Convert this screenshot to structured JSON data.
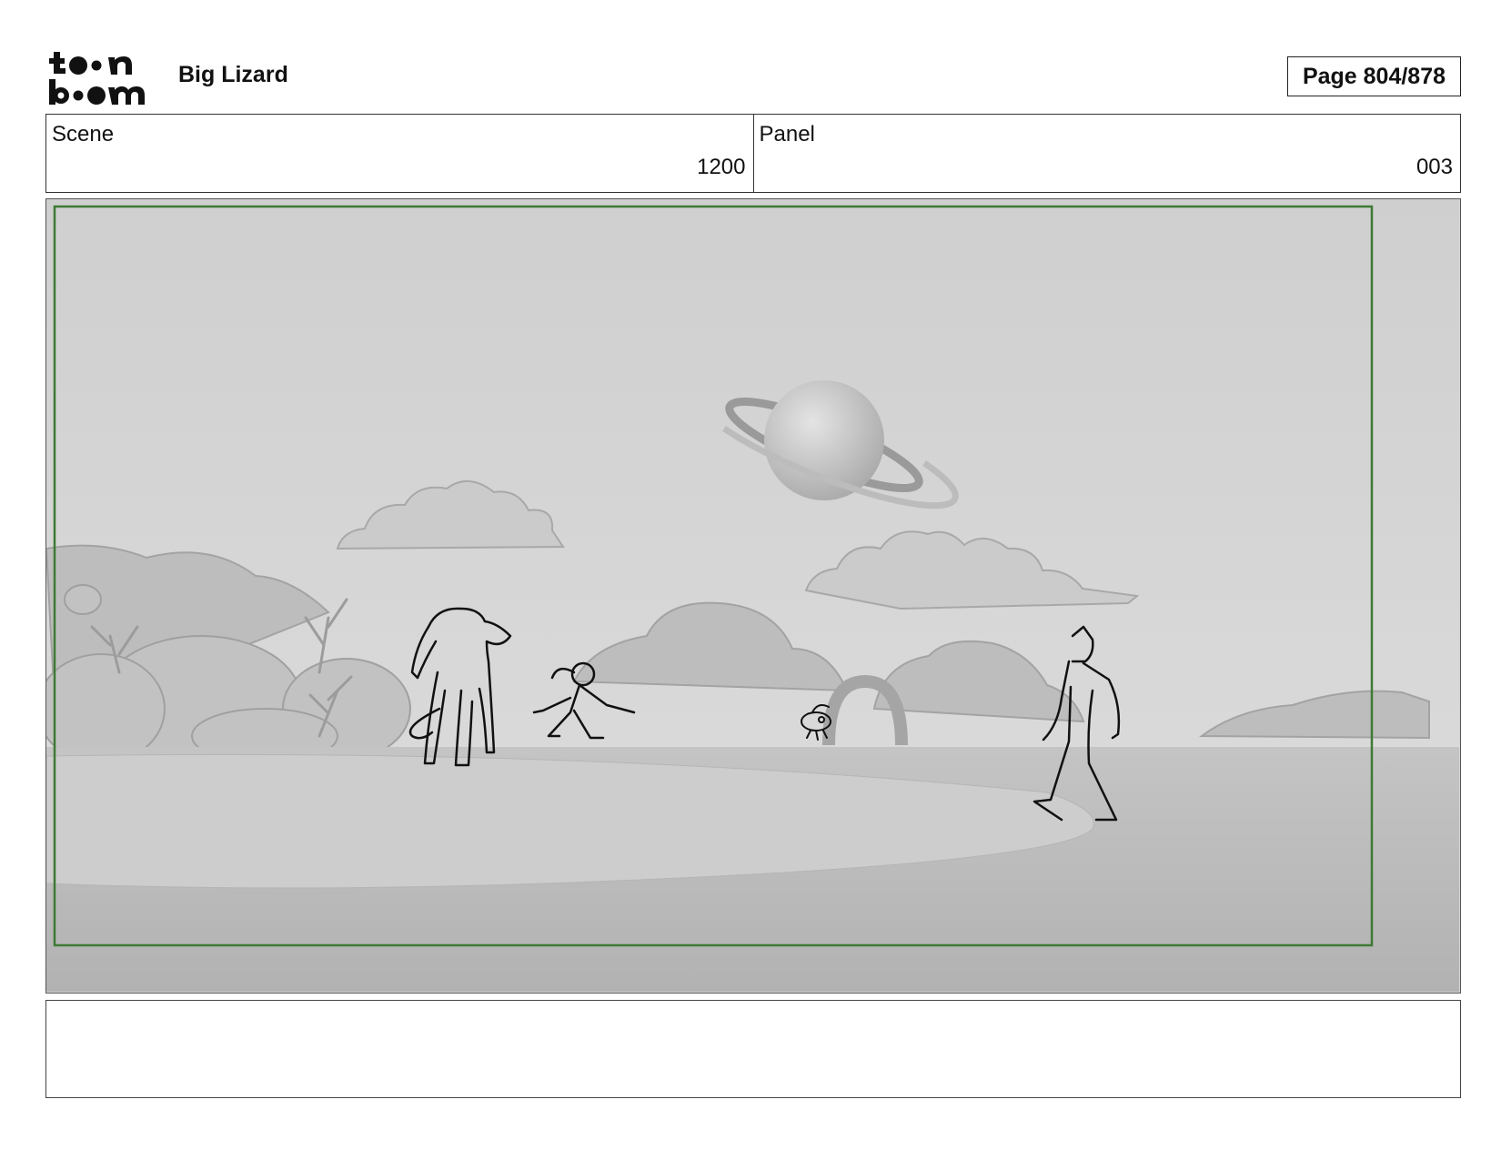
{
  "header": {
    "logo_text": "toon boom",
    "project_title": "Big Lizard",
    "page_label": "Page 804/878"
  },
  "info": {
    "scene_label": "Scene",
    "scene_value": "1200",
    "panel_label": "Panel",
    "panel_value": "003"
  },
  "notes": {
    "text": ""
  }
}
